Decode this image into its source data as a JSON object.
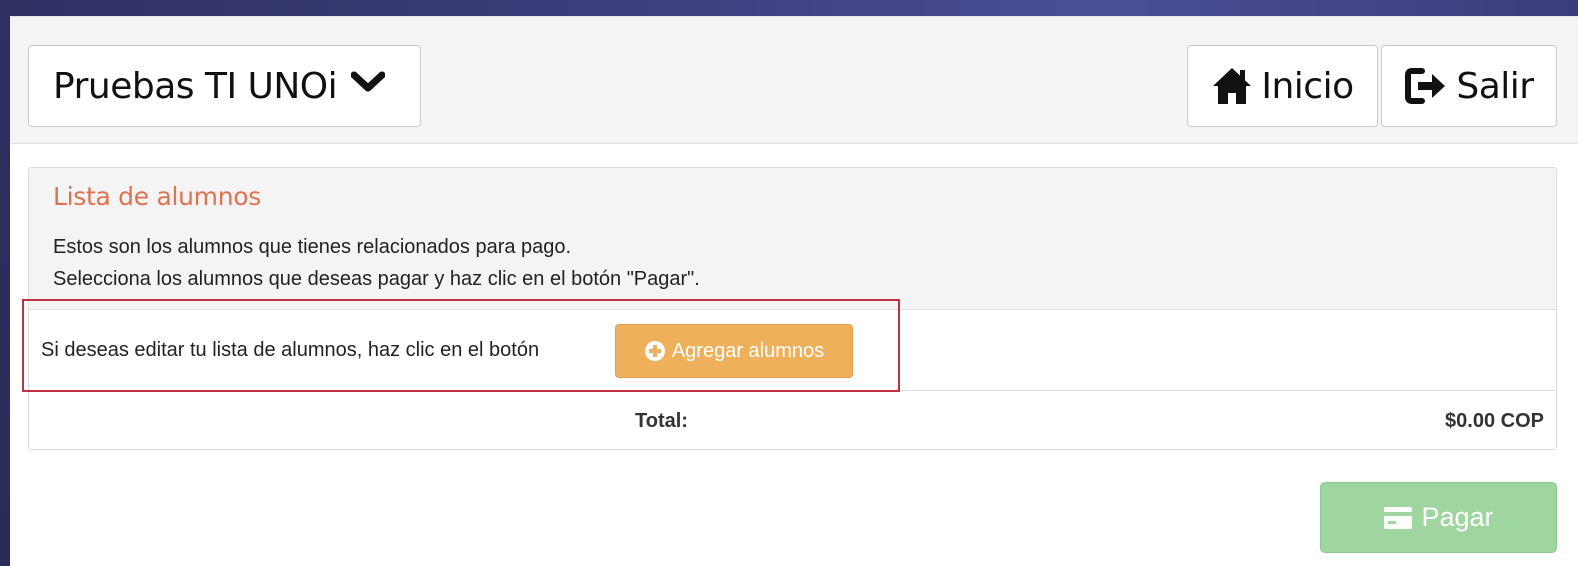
{
  "navbar": {
    "brand_label": "Pruebas TI UNOi",
    "brand_icon": "chevron-down-icon",
    "home_label": "Inicio",
    "home_icon": "home-icon",
    "exit_label": "Salir",
    "exit_icon": "sign-out-icon"
  },
  "panel": {
    "title": "Lista de alumnos",
    "description_line1": "Estos son los alumnos que tienes relacionados para pago.",
    "description_line2": "Selecciona los alumnos que deseas pagar y haz clic en el botón \"Pagar\".",
    "edit_text": "Si deseas editar tu lista de alumnos, haz clic en el botón",
    "add_button_label": "Agregar alumnos",
    "add_button_icon": "plus-circle-icon",
    "total_label": "Total:",
    "total_value": "$0.00 COP"
  },
  "footer": {
    "pay_button_label": "Pagar",
    "pay_button_icon": "credit-card-icon"
  },
  "colors": {
    "title_accent": "#e0734f",
    "add_button": "#eeb05b",
    "pay_button": "#9fd59e",
    "highlight_border": "#c13040"
  }
}
